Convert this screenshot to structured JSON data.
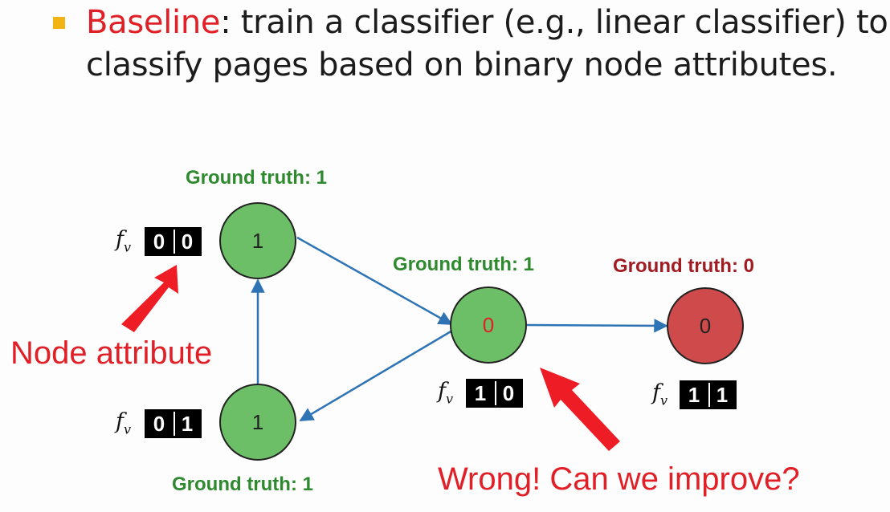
{
  "bullet": {
    "keyword": "Baseline",
    "text": ": train a classifier (e.g., linear classifier) to classify pages based on binary node attributes."
  },
  "nodes": [
    {
      "id": "top-left",
      "value": "1",
      "ground_truth": "Ground truth: 1",
      "attributes": [
        "0",
        "0"
      ],
      "fill": "#6dbf67",
      "label_color": "#222222",
      "gt_color": "#2f8a2f"
    },
    {
      "id": "bottom-left",
      "value": "1",
      "ground_truth": "Ground truth: 1",
      "attributes": [
        "0",
        "1"
      ],
      "fill": "#6dbf67",
      "label_color": "#222222",
      "gt_color": "#2f8a2f"
    },
    {
      "id": "center",
      "value": "0",
      "ground_truth": "Ground truth: 1",
      "attributes": [
        "1",
        "0"
      ],
      "fill": "#6dbf67",
      "label_color": "#e11f26",
      "gt_color": "#2f8a2f"
    },
    {
      "id": "right",
      "value": "0",
      "ground_truth": "Ground truth: 0",
      "attributes": [
        "1",
        "1"
      ],
      "fill": "#cf4b4b",
      "label_color": "#222222",
      "gt_color": "#a01b22"
    }
  ],
  "feature_symbol": "f",
  "feature_subscript": "v",
  "annotations": {
    "node_attribute": "Node attribute",
    "wrong": "Wrong! Can we improve?"
  },
  "colors": {
    "accent_red": "#e11f26",
    "edge_blue": "#2e74b5",
    "bullet_yellow": "#f2b315"
  }
}
